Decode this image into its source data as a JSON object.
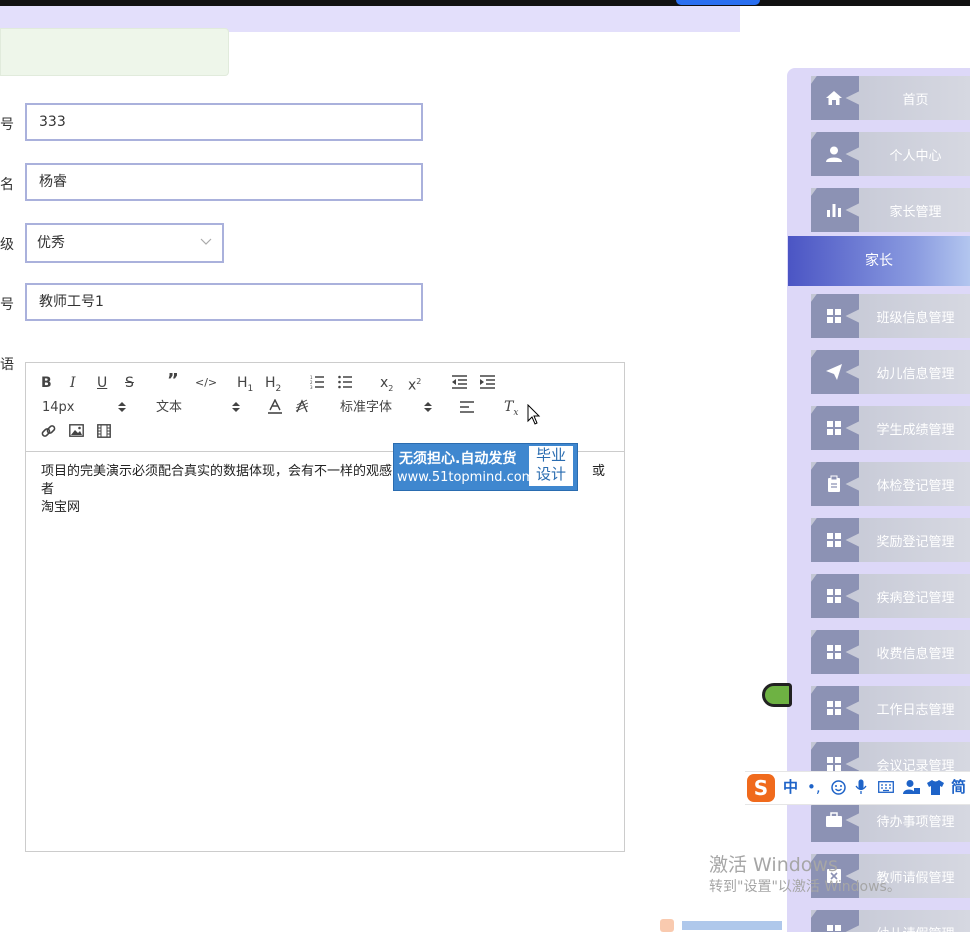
{
  "form": {
    "field1": {
      "label": "号",
      "value": "333"
    },
    "field2": {
      "label": "名",
      "value": "杨睿"
    },
    "field3": {
      "label": "级",
      "value": "优秀"
    },
    "field4": {
      "label": "号",
      "value": "教师工号1"
    },
    "field5": {
      "label": "语"
    }
  },
  "editor": {
    "size_select": "14px",
    "block_select": "文本",
    "font_select": "标准字体",
    "content": "项目的完美演示必须配合真实的数据体现，会有不一样的观感",
    "content_tail": "或者",
    "content_line2": "淘宝网"
  },
  "overlay_badge": {
    "main": "无须担心.自动发货",
    "url": "www.51topmind.com",
    "side_line1": "毕业",
    "side_line2": "设计"
  },
  "sidebar": {
    "items": [
      {
        "label": "首页",
        "icon": "home-icon"
      },
      {
        "label": "个人中心",
        "icon": "user-icon"
      },
      {
        "label": "家长管理",
        "icon": "bar-chart-icon"
      },
      {
        "label": "家长",
        "icon": "",
        "active": true
      },
      {
        "label": "班级信息管理",
        "icon": "grid-icon"
      },
      {
        "label": "幼儿信息管理",
        "icon": "send-icon"
      },
      {
        "label": "学生成绩管理",
        "icon": "grid-icon"
      },
      {
        "label": "体检登记管理",
        "icon": "clipboard-icon"
      },
      {
        "label": "奖励登记管理",
        "icon": "grid-icon"
      },
      {
        "label": "疾病登记管理",
        "icon": "grid-icon"
      },
      {
        "label": "收费信息管理",
        "icon": "grid-icon"
      },
      {
        "label": "工作日志管理",
        "icon": "grid-icon"
      },
      {
        "label": "会议记录管理",
        "icon": "grid-icon"
      },
      {
        "label": "待办事项管理",
        "icon": "briefcase-icon"
      },
      {
        "label": "教师请假管理",
        "icon": "close-box-icon"
      },
      {
        "label": "幼儿请假管理",
        "icon": "grid-icon"
      }
    ]
  },
  "ime": {
    "logo": "S",
    "mode": "中",
    "punct": "•,",
    "simp": "简"
  },
  "watermark": {
    "line1": "激活 Windows",
    "line2": "转到\"设置\"以激活 Windows。"
  },
  "colors": {
    "accent": "#4b55c4",
    "input_border": "#aab1dc",
    "sidebar_bg": "#ddd8f8"
  }
}
